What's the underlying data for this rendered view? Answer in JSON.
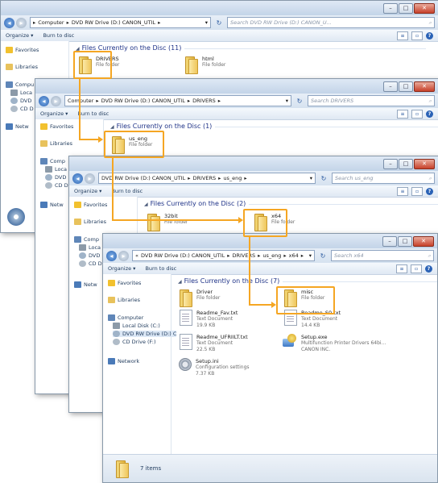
{
  "windows": [
    {
      "address": [
        "Computer",
        "DVD RW Drive (D:) CANON_UTIL"
      ],
      "search_placeholder": "Search DVD RW Drive (D:) CANON_U...",
      "organize": "Organize ▾",
      "burn": "Burn to disc",
      "nav": [
        "Favorites",
        "Libraries",
        "Compu",
        "Loca",
        "DVD",
        "CD D",
        "Netw"
      ],
      "group": "Files Currently on the Disc (11)",
      "items": [
        {
          "name": "DRIVERS",
          "type": "File folder"
        },
        {
          "name": "html",
          "type": "File folder"
        }
      ]
    },
    {
      "address": [
        "Computer",
        "DVD RW Drive (D:) CANON_UTIL",
        "DRIVERS"
      ],
      "search_placeholder": "Search DRIVERS",
      "organize": "Organize ▾",
      "burn": "Burn to disc",
      "nav": [
        "Favorites",
        "Libraries",
        "Comp",
        "Loca",
        "DVD",
        "CD D",
        "Netw"
      ],
      "group": "Files Currently on the Disc (1)",
      "items": [
        {
          "name": "us_eng",
          "type": "File folder"
        }
      ]
    },
    {
      "address": [
        "DVD RW Drive (D:) CANON_UTIL",
        "DRIVERS",
        "us_eng"
      ],
      "search_placeholder": "Search us_eng",
      "organize": "Organize ▾",
      "burn": "Burn to disc",
      "nav": [
        "Favorites",
        "Libraries",
        "Comp",
        "Loca",
        "DVD",
        "CD D",
        "Netw"
      ],
      "group": "Files Currently on the Disc (2)",
      "items": [
        {
          "name": "32bit",
          "type": "File folder"
        },
        {
          "name": "x64",
          "type": "File folder"
        }
      ]
    },
    {
      "address_prefix": "«",
      "address": [
        "DVD RW Drive (D:) CANON_UTIL",
        "DRIVERS",
        "us_eng",
        "x64"
      ],
      "search_placeholder": "Search x64",
      "organize": "Organize ▾",
      "burn": "Burn to disc",
      "nav": [
        "Favorites",
        "Libraries",
        "Computer",
        "Local Disk (C:)",
        "DVD RW Drive (D:) C",
        "CD Drive (F:)",
        "Network"
      ],
      "group": "Files Currently on the Disc (7)",
      "items": [
        {
          "name": "Driver",
          "type": "File folder"
        },
        {
          "name": "misc",
          "type": "File folder"
        },
        {
          "name": "Readme_Fav.txt",
          "type": "Text Document",
          "size": "19.9 KB"
        },
        {
          "name": "Readme_S0.txt",
          "type": "Text Document",
          "size": "14.4 KB"
        },
        {
          "name": "Readme_UFRIILT.txt",
          "type": "Text Document",
          "size": "22.5 KB"
        },
        {
          "name": "Setup.exe",
          "type": "Multifunction Printer Drivers 64bi...",
          "size": "CANON INC."
        },
        {
          "name": "Setup.ini",
          "type": "Configuration settings",
          "size": "7.37 KB"
        }
      ],
      "status": "7 items"
    }
  ],
  "colors": {
    "highlight": "#f5a623",
    "group_text": "#1e3287"
  }
}
